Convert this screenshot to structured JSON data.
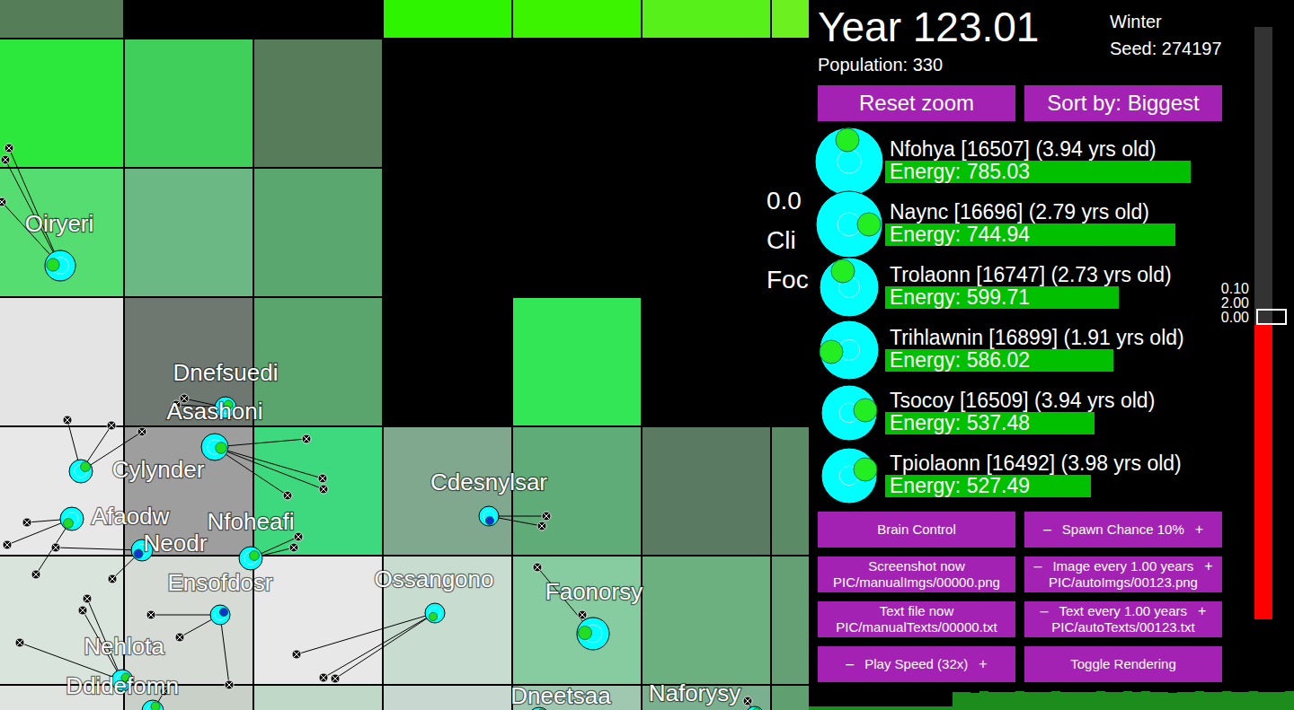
{
  "map": {
    "tiles": [
      [
        "#557d57",
        "#000000",
        "#000000",
        "#2ef400",
        "#3cf300",
        "#58f01a",
        "#6cf020"
      ],
      [
        "#2ce83c",
        "#40cf5a",
        "#567c5a",
        "#000000",
        "#000000",
        "#000000",
        "#000000"
      ],
      [
        "#55dd72",
        "#6cb884",
        "#5aa870",
        "#000000",
        "#000000",
        "#000000",
        "#000000"
      ],
      [
        "#e4e4e4",
        "#6e7870",
        "#5aa46e",
        "#000000",
        "#33e655",
        "#000000",
        "#000000"
      ],
      [
        "#e8e8e8",
        "#9e9e9e",
        "#3ed97e",
        "#7fa88f",
        "#5fac78",
        "#5a7a62",
        "#5a8a66"
      ],
      [
        "#d8e4dc",
        "#d6dbd6",
        "#e8e8e8",
        "#c8dcd0",
        "#86cca0",
        "#6cb080",
        "#64a074"
      ],
      [
        "#e0e4e0",
        "#c8d0c8",
        "#c0d8c8",
        "#c8d8d0",
        "#a0c8b0",
        "#7ab090",
        "#60a070"
      ]
    ],
    "cut_labels": [
      "0.0",
      "Cli",
      "Foc"
    ]
  },
  "creatures": [
    {
      "name": "Oiryeri",
      "color": "#22dd22"
    },
    {
      "name": "Dnefsuedi",
      "color": "#22dd22"
    },
    {
      "name": "Asashoni",
      "color": "#22dd22"
    },
    {
      "name": "Cylynder",
      "color": "#22dd22"
    },
    {
      "name": "Afaodw",
      "color": "#22dd22"
    },
    {
      "name": "Neodr",
      "color": "#1133cc"
    },
    {
      "name": "Nfoheafi",
      "color": "#22dd22"
    },
    {
      "name": "Ensofdosr",
      "color": "#1133cc"
    },
    {
      "name": "Cdesnylsar",
      "color": "#1133cc"
    },
    {
      "name": "Ossangono",
      "color": "#22dd22"
    },
    {
      "name": "Faonorsy",
      "color": "#22dd22"
    },
    {
      "name": "Nehlota",
      "color": "#22dd22"
    },
    {
      "name": "Ddidefomn",
      "color": "#22dd22"
    },
    {
      "name": "Dneetsaa",
      "color": "#22dd22"
    },
    {
      "name": "Naforysy",
      "color": "#22dd22"
    }
  ],
  "panel": {
    "year": "Year 123.01",
    "season": "Winter",
    "seed": "Seed: 274197",
    "population": "Population: 330",
    "top_buttons": [
      "Reset zoom",
      "Sort by: Biggest"
    ],
    "list": [
      {
        "name": "Nfohya [16507] (3.94 yrs old)",
        "energy": "Energy: 785.03",
        "level": 0.907
      },
      {
        "name": "Naync [16696] (2.79 yrs old)",
        "energy": "Energy: 744.94",
        "level": 0.861
      },
      {
        "name": "Trolaonn [16747] (2.73 yrs old)",
        "energy": "Energy: 599.71",
        "level": 0.693
      },
      {
        "name": "Trihlawnin [16899] (1.91 yrs old)",
        "energy": "Energy: 586.02",
        "level": 0.677
      },
      {
        "name": "Tsocoy [16509] (3.94 yrs old)",
        "energy": "Energy: 537.48",
        "level": 0.621
      },
      {
        "name": "Tpiolaonn [16492] (3.98 yrs old)",
        "energy": "Energy: 527.49",
        "level": 0.611
      }
    ],
    "temperature": {
      "level": 0.497,
      "labels": [
        "0.10",
        "2.00",
        "0.00"
      ]
    },
    "buttons": [
      {
        "label": "Brain Control",
        "sub": "",
        "minus": "",
        "plus": ""
      },
      {
        "label": "Spawn Chance 10%",
        "sub": "",
        "minus": "–",
        "plus": "+"
      },
      {
        "label": "Screenshot now",
        "sub": "PIC/manualImgs/00000.png",
        "minus": "",
        "plus": ""
      },
      {
        "label": "Image every 1.00 years",
        "sub": "PIC/autoImgs/00123.png",
        "minus": "–",
        "plus": "+"
      },
      {
        "label": "Text file now",
        "sub": "PIC/manualTexts/00000.txt",
        "minus": "",
        "plus": ""
      },
      {
        "label": "Text every 1.00 years",
        "sub": "PIC/autoTexts/00123.txt",
        "minus": "–",
        "plus": "+"
      },
      {
        "label": "Play Speed (32x)",
        "sub": "",
        "minus": "–",
        "plus": "+"
      },
      {
        "label": "Toggle Rendering",
        "sub": "",
        "minus": "",
        "plus": ""
      }
    ],
    "chart": {
      "values": [
        64,
        62,
        66,
        63,
        65,
        61,
        64,
        66,
        63,
        62,
        65,
        64,
        63,
        66,
        64,
        62,
        318,
        326,
        312,
        330,
        322,
        315,
        328,
        334,
        320,
        317,
        325,
        331,
        319,
        327,
        314,
        322,
        330,
        324,
        316,
        329,
        321,
        333,
        318,
        326,
        312,
        327,
        320,
        331,
        323,
        317,
        329,
        325,
        319,
        332,
        315,
        326,
        322,
        330
      ]
    }
  }
}
